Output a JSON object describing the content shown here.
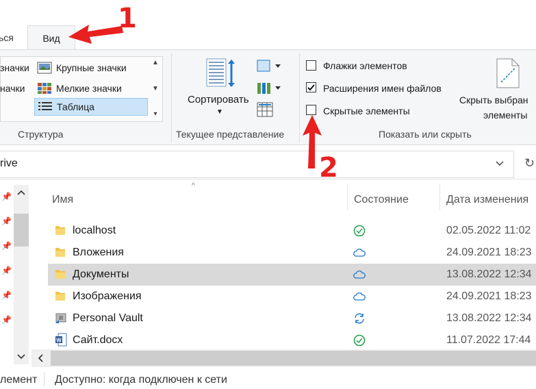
{
  "tabs": {
    "previous": "ься",
    "active": "Вид"
  },
  "ribbon": {
    "layout": {
      "items": [
        {
          "left_text": "значки",
          "right_text": "Крупные значки"
        },
        {
          "left_text": "начки",
          "right_text": "Мелкие значки"
        },
        {
          "left_text": "",
          "right_text": "Таблица"
        }
      ],
      "group_label": "Структура"
    },
    "current_view": {
      "sort_label": "Сортировать",
      "group_label": "Текущее представление"
    },
    "show_hide": {
      "checkboxes": [
        {
          "label": "Флажки элементов",
          "checked": false
        },
        {
          "label": "Расширения имен файлов",
          "checked": true
        },
        {
          "label": "Скрытые элементы",
          "checked": false
        }
      ],
      "hide_selected_line1": "Скрыть выбран",
      "hide_selected_line2": "элементы",
      "group_label": "Показать или скрыть"
    }
  },
  "address": {
    "path_fragment": "rive"
  },
  "columns": {
    "name": "Имя",
    "status": "Состояние",
    "date": "Дата изменения"
  },
  "files": [
    {
      "name": "localhost",
      "date": "02.05.2022 11:02",
      "status": "synced",
      "type": "folder"
    },
    {
      "name": "Вложения",
      "date": "24.09.2021 18:23",
      "status": "cloud",
      "type": "folder"
    },
    {
      "name": "Документы",
      "date": "13.08.2022 12:34",
      "status": "cloud",
      "type": "folder",
      "selected": true
    },
    {
      "name": "Изображения",
      "date": "24.09.2021 18:23",
      "status": "cloud",
      "type": "folder"
    },
    {
      "name": "Personal Vault",
      "date": "13.08.2022 12:34",
      "status": "syncing",
      "type": "vault"
    },
    {
      "name": "Сайт.docx",
      "date": "11.07.2022 17:44",
      "status": "synced",
      "type": "word"
    }
  ],
  "statusbar": {
    "count_fragment": "лемент",
    "availability": "Доступно: когда подключен к сети"
  },
  "annotations": {
    "one": "1",
    "two": "2"
  },
  "colors": {
    "arrow": "#e82020",
    "accent_blue": "#1f78c8",
    "ok_green": "#23a04a"
  }
}
